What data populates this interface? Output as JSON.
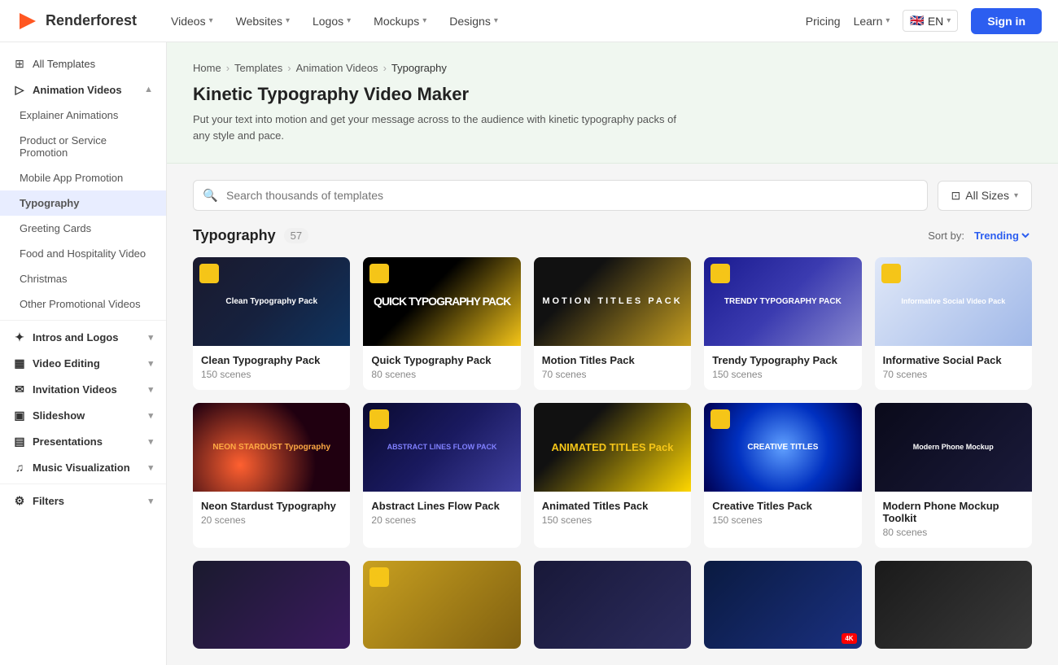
{
  "header": {
    "logo_text": "Renderforest",
    "nav_items": [
      {
        "label": "Videos",
        "has_dropdown": true
      },
      {
        "label": "Websites",
        "has_dropdown": true
      },
      {
        "label": "Logos",
        "has_dropdown": true
      },
      {
        "label": "Mockups",
        "has_dropdown": true
      },
      {
        "label": "Designs",
        "has_dropdown": true
      }
    ],
    "pricing_label": "Pricing",
    "learn_label": "Learn",
    "sign_in_label": "Sign in",
    "lang": "EN"
  },
  "sidebar": {
    "sections": [
      {
        "items": [
          {
            "label": "All Templates",
            "icon": "grid",
            "type": "parent",
            "active": false
          },
          {
            "label": "Animation Videos",
            "icon": "play-circle",
            "type": "parent",
            "expanded": true,
            "active": false
          }
        ]
      },
      {
        "items": [
          {
            "label": "Explainer Animations",
            "type": "sub",
            "active": false
          },
          {
            "label": "Product or Service Promotion",
            "type": "sub",
            "active": false
          },
          {
            "label": "Mobile App Promotion",
            "type": "sub",
            "active": false
          },
          {
            "label": "Typography",
            "type": "sub",
            "active": true
          },
          {
            "label": "Greeting Cards",
            "type": "sub",
            "active": false
          },
          {
            "label": "Food and Hospitality Video",
            "type": "sub",
            "active": false
          },
          {
            "label": "Christmas",
            "type": "sub",
            "active": false
          },
          {
            "label": "Other Promotional Videos",
            "type": "sub",
            "active": false
          }
        ]
      },
      {
        "items": [
          {
            "label": "Intros and Logos",
            "icon": "star",
            "type": "parent",
            "active": false
          },
          {
            "label": "Video Editing",
            "icon": "film",
            "type": "parent",
            "active": false
          },
          {
            "label": "Invitation Videos",
            "icon": "mail",
            "type": "parent",
            "active": false
          },
          {
            "label": "Slideshow",
            "icon": "monitor",
            "type": "parent",
            "active": false
          },
          {
            "label": "Presentations",
            "icon": "bar-chart",
            "type": "parent",
            "active": false
          },
          {
            "label": "Music Visualization",
            "icon": "music",
            "type": "parent",
            "active": false
          }
        ]
      },
      {
        "items": [
          {
            "label": "Filters",
            "icon": "filter",
            "type": "parent",
            "active": false
          }
        ]
      }
    ]
  },
  "breadcrumb": {
    "items": [
      "Home",
      "Templates",
      "Animation Videos",
      "Typography"
    ]
  },
  "banner": {
    "title": "Kinetic Typography Video Maker",
    "description": "Put your text into motion and get your message across to the audience with kinetic typography packs of any style and pace."
  },
  "search": {
    "placeholder": "Search thousands of templates"
  },
  "filter_btn": {
    "label": "All Sizes"
  },
  "section": {
    "title": "Typography",
    "count": "57",
    "sort_label": "Sort by:",
    "sort_value": "Trending"
  },
  "templates_row1": [
    {
      "title": "Clean Typography Pack",
      "scenes": "150 scenes",
      "thumb_class": "thumb-1",
      "thumb_text": "Clean Typography Pack",
      "badge": true,
      "text_style": "thumb-text-clean"
    },
    {
      "title": "Quick Typography Pack",
      "scenes": "80 scenes",
      "thumb_class": "thumb-2",
      "thumb_text": "QUICK TYPOGRAPHY PACK",
      "badge": true,
      "text_style": "thumb-text-quick"
    },
    {
      "title": "Motion Titles Pack",
      "scenes": "70 scenes",
      "thumb_class": "thumb-3",
      "thumb_text": "MOTION TITLES PACK",
      "badge": false,
      "text_style": "thumb-text-motion"
    },
    {
      "title": "Trendy Typography Pack",
      "scenes": "150 scenes",
      "thumb_class": "thumb-4",
      "thumb_text": "TRENDY TYPOGRAPHY PACK",
      "badge": true,
      "text_style": "thumb-text-trendy"
    },
    {
      "title": "Informative Social Pack",
      "scenes": "70 scenes",
      "thumb_class": "thumb-5",
      "thumb_text": "Informative Social Video Pack",
      "badge": true,
      "text_style": "thumb-text-info"
    }
  ],
  "templates_row2": [
    {
      "title": "Neon Stardust Typography",
      "scenes": "20 scenes",
      "thumb_class": "thumb-6",
      "thumb_text": "NEON STARDUST Typography",
      "badge": false,
      "text_style": "thumb-text-neon"
    },
    {
      "title": "Abstract Lines Flow Pack",
      "scenes": "20 scenes",
      "thumb_class": "thumb-7",
      "thumb_text": "ABSTRACT LINES FLOW PACK",
      "badge": true,
      "text_style": "thumb-text-abstract"
    },
    {
      "title": "Animated Titles Pack",
      "scenes": "150 scenes",
      "thumb_class": "thumb-8",
      "thumb_text": "ANIMATED TITLES Pack",
      "badge": false,
      "text_style": "thumb-text-animated"
    },
    {
      "title": "Creative Titles Pack",
      "scenes": "150 scenes",
      "thumb_class": "thumb-9",
      "thumb_text": "CREATIVE TITLES",
      "badge": true,
      "text_style": "thumb-text-creative"
    },
    {
      "title": "Modern Phone Mockup Toolkit",
      "scenes": "80 scenes",
      "thumb_class": "thumb-10",
      "thumb_text": "Modern Phone Mockup",
      "badge": false,
      "text_style": "thumb-text-phone"
    }
  ],
  "templates_row3_thumb_classes": [
    "thumb-bottom-1",
    "thumb-bottom-2",
    "thumb-bottom-3",
    "thumb-bottom-4",
    "thumb-bottom-5"
  ]
}
